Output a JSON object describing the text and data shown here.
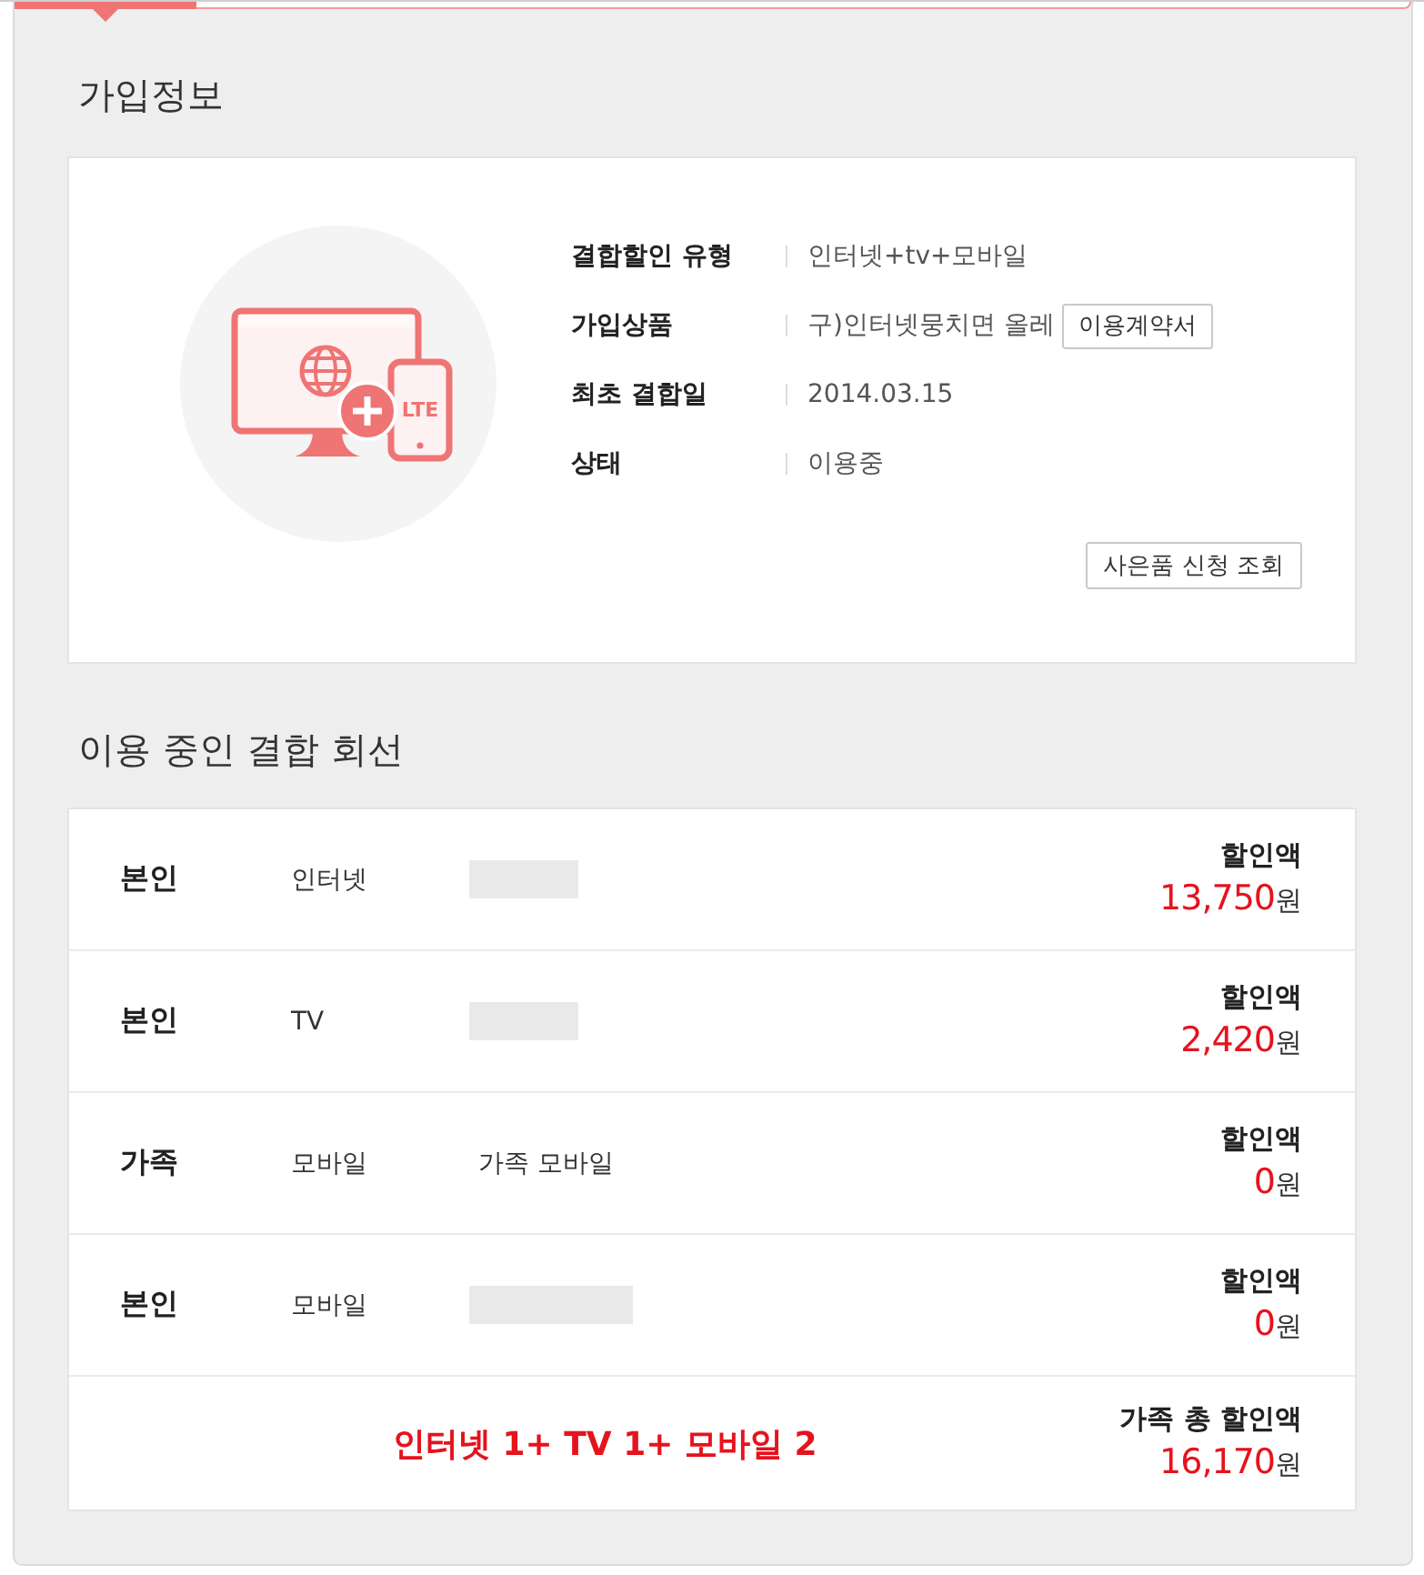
{
  "subscription": {
    "title": "가입정보",
    "illustration": {
      "badge": "LTE"
    },
    "fields": [
      {
        "label": "결합할인 유형",
        "value": "인터넷+tv+모바일"
      },
      {
        "label": "가입상품",
        "value": "구)인터넷뭉치면 올레",
        "button": "이용계약서"
      },
      {
        "label": "최초 결합일",
        "value": "2014.03.15"
      },
      {
        "label": "상태",
        "value": "이용중"
      }
    ],
    "gift_button": "사은품 신청 조회"
  },
  "lines": {
    "title": "이용 중인 결합 회선",
    "rows": [
      {
        "owner": "본인",
        "service": "인터넷",
        "masked": true,
        "amount_label": "할인액",
        "amount": "13,750",
        "unit": "원"
      },
      {
        "owner": "본인",
        "service": "TV",
        "masked": true,
        "amount_label": "할인액",
        "amount": "2,420",
        "unit": "원"
      },
      {
        "owner": "가족",
        "service": "모바일",
        "detail": "가족 모바일",
        "masked": false,
        "amount_label": "할인액",
        "amount": "0",
        "unit": "원"
      },
      {
        "owner": "본인",
        "service": "모바일",
        "masked": true,
        "amount_label": "할인액",
        "amount": "0",
        "unit": "원"
      }
    ],
    "summary": {
      "combo": "인터넷 1+ TV 1+ 모바일 2",
      "amount_label": "가족 총 할인액",
      "amount": "16,170",
      "unit": "원"
    }
  }
}
